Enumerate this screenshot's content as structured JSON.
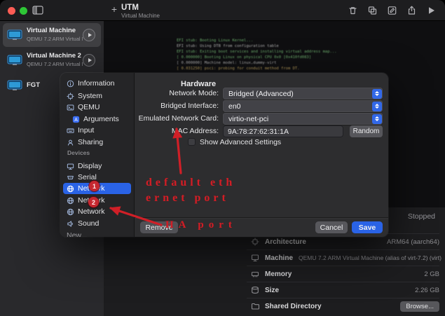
{
  "colors": {
    "accent_blue": "#2a63e6",
    "annotation_red": "#d01f27",
    "status_gray": "#95959a"
  },
  "titlebar": {
    "title": "UTM",
    "subtitle": "Virtual Machine"
  },
  "vm_sidebar": {
    "items": [
      {
        "title": "Virtual Machine",
        "subtitle": "QEMU 7.2 ARM Virtual M..."
      },
      {
        "title": "Virtual Machine 2",
        "subtitle": "QEMU 7.2 ARM Virtual M..."
      },
      {
        "title": "FGT",
        "subtitle": ""
      }
    ]
  },
  "console": {
    "lines": [
      {
        "text": "EFI stub: Booting Linux Kernel..."
      },
      {
        "text": "EFI stub: Using DTB from configuration table"
      },
      {
        "text": "EFI stub: Exiting boot services and installing virtual address map..."
      },
      {
        "text": "[    0.000000] Booting Linux on physical CPU 0x0 [0x410fd083]"
      },
      {
        "text": "[    0.000000] Machine model: linux,dummy-virt"
      },
      {
        "text": "[    0.031250] psci: probing for conduit method from DT."
      }
    ]
  },
  "dialog": {
    "nav": {
      "items": [
        {
          "label": "Information"
        },
        {
          "label": "System"
        },
        {
          "label": "QEMU"
        },
        {
          "label": "Arguments"
        },
        {
          "label": "Input"
        },
        {
          "label": "Sharing"
        }
      ],
      "section_label": "Devices",
      "device_items": [
        {
          "label": "Display"
        },
        {
          "label": "Serial"
        },
        {
          "label": "Network"
        },
        {
          "label": "Network"
        },
        {
          "label": "Network"
        },
        {
          "label": "Sound"
        }
      ],
      "new_label": "New..."
    },
    "content": {
      "heading": "Hardware",
      "rows": [
        {
          "label": "Network Mode:",
          "value": "Bridged (Advanced)"
        },
        {
          "label": "Bridged Interface:",
          "value": "en0"
        },
        {
          "label": "Emulated Network Card:",
          "value": "virtio-net-pci"
        }
      ],
      "mac": {
        "label": "MAC Address:",
        "value": "9A:78:27:62:31:1A",
        "button": "Random"
      },
      "checkbox_label": "Show Advanced Settings",
      "footer": {
        "remove": "Remove",
        "cancel": "Cancel",
        "save": "Save"
      }
    }
  },
  "details": {
    "status": "Stopped",
    "rows": [
      {
        "label": "Architecture",
        "value": "ARM64 (aarch64)"
      },
      {
        "label": "Machine",
        "value": "QEMU 7.2 ARM Virtual Machine (alias of virt-7.2) (virt)"
      },
      {
        "label": "Memory",
        "value": "2 GB"
      },
      {
        "label": "Size",
        "value": "2.26 GB"
      },
      {
        "label": "Shared Directory",
        "value": "",
        "button": "Browse..."
      }
    ]
  },
  "annotations": {
    "badge_1": "1",
    "badge_2": "2",
    "note_eth_line1": "default eth",
    "note_eth_line2": "ernet port",
    "note_ha": "HA port"
  }
}
